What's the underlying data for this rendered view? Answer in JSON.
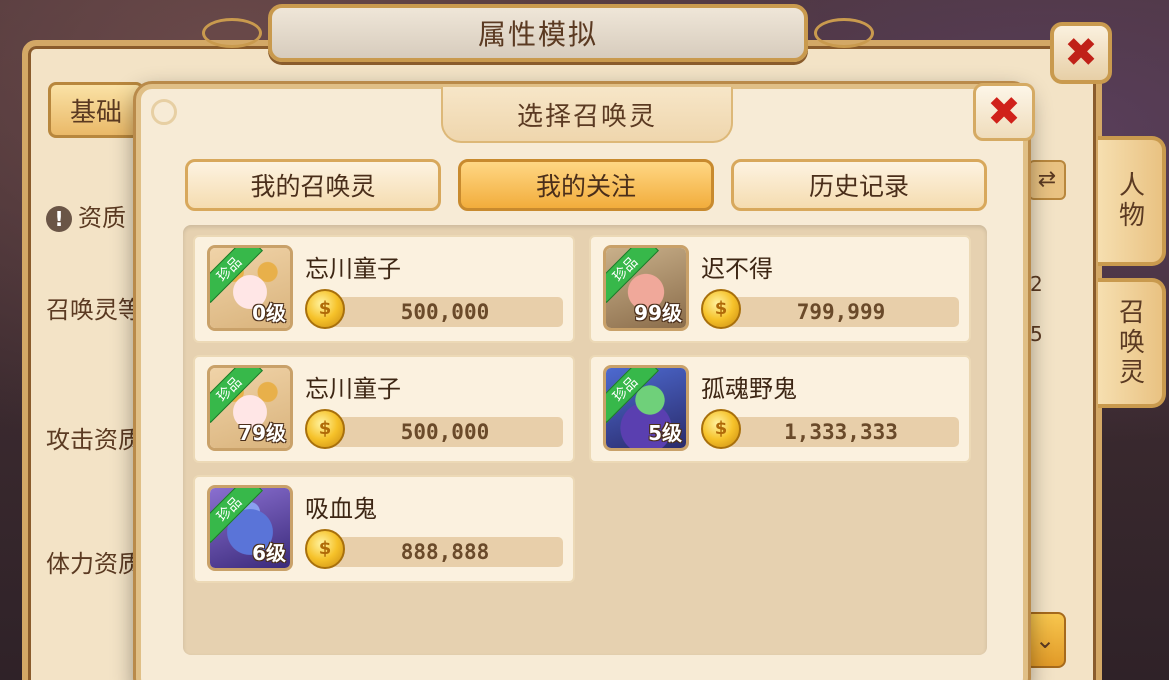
{
  "outer": {
    "title": "属性模拟",
    "tab_basic": "基础",
    "labels": {
      "aptitude": "资质",
      "summon_level": "召唤灵等",
      "attack_aptitude": "攻击资质",
      "stamina_aptitude": "体力资质"
    },
    "side_tabs": {
      "character": "人物",
      "summon": "召唤灵"
    },
    "values": [
      "2",
      "5"
    ]
  },
  "modal": {
    "title": "选择召唤灵",
    "tabs": [
      {
        "label": "我的召唤灵",
        "active": false
      },
      {
        "label": "我的关注",
        "active": true
      },
      {
        "label": "历史记录",
        "active": false
      }
    ],
    "rare_label": "珍品",
    "pets": [
      {
        "name": "忘川童子",
        "level": "0级",
        "price": "500,000",
        "art": "lamb"
      },
      {
        "name": "迟不得",
        "level": "99级",
        "price": "799,999",
        "art": "pig"
      },
      {
        "name": "忘川童子",
        "level": "79级",
        "price": "500,000",
        "art": "lamb"
      },
      {
        "name": "孤魂野鬼",
        "level": "5级",
        "price": "1,333,333",
        "art": "ghost"
      },
      {
        "name": "吸血鬼",
        "level": "6级",
        "price": "888,888",
        "art": "vamp"
      }
    ]
  },
  "icons": {
    "close": "close-icon",
    "coin": "coin-icon",
    "swap": "swap-icon",
    "chevron": "chevron-down-icon",
    "warning": "warning-icon"
  },
  "colors": {
    "close_x": "#d0211a",
    "active_tab": "#f2ad3c",
    "rare_ribbon": "#37b84a",
    "panel_bg": "#f7ebd6"
  }
}
